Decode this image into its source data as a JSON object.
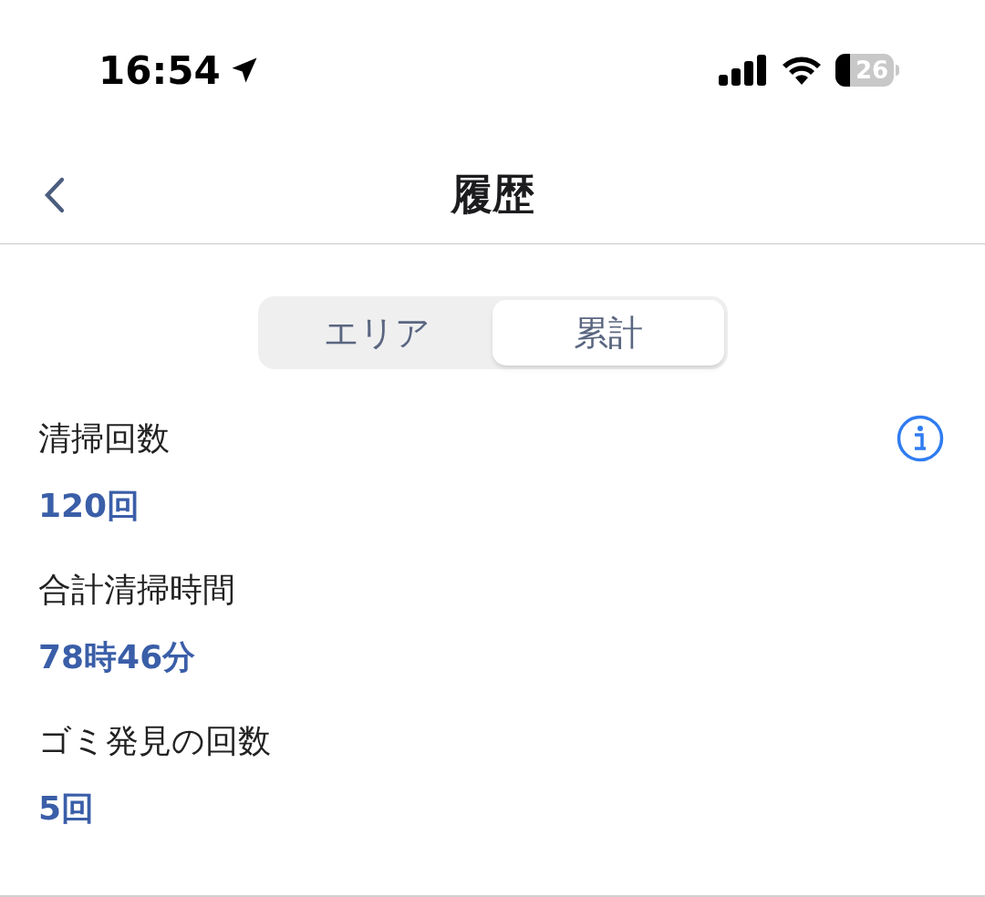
{
  "status_bar": {
    "time": "16:54",
    "battery": "26"
  },
  "nav": {
    "title": "履歴"
  },
  "segments": [
    {
      "label": "エリア",
      "selected": false
    },
    {
      "label": "累計",
      "selected": true
    }
  ],
  "stats": [
    {
      "label": "清掃回数",
      "value": "120回"
    },
    {
      "label": "合計清掃時間",
      "value": "78時46分"
    },
    {
      "label": "ゴミ発見の回数",
      "value": "5回"
    }
  ]
}
